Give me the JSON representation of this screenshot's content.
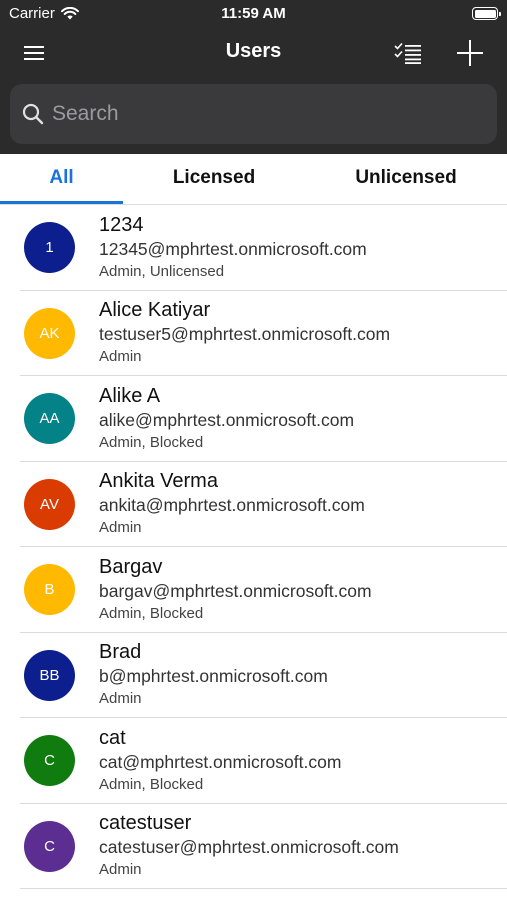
{
  "status": {
    "carrier": "Carrier",
    "time": "11:59 AM"
  },
  "nav": {
    "title": "Users",
    "menu_icon": "hamburger-icon",
    "select_icon": "checklist-icon",
    "add_icon": "plus-icon"
  },
  "search": {
    "placeholder": "Search"
  },
  "tabs": [
    {
      "label": "All",
      "active": true
    },
    {
      "label": "Licensed"
    },
    {
      "label": "Unlicensed"
    }
  ],
  "users": [
    {
      "initials": "1",
      "name": "1234",
      "email": "12345@mphrtest.onmicrosoft.com",
      "roles": "Admin, Unlicensed",
      "color": "#0d1f8f"
    },
    {
      "initials": "AK",
      "name": "Alice Katiyar",
      "email": "testuser5@mphrtest.onmicrosoft.com",
      "roles": "Admin",
      "color": "#ffb900"
    },
    {
      "initials": "AA",
      "name": "Alike A",
      "email": "alike@mphrtest.onmicrosoft.com",
      "roles": "Admin, Blocked",
      "color": "#038387"
    },
    {
      "initials": "AV",
      "name": "Ankita Verma",
      "email": "ankita@mphrtest.onmicrosoft.com",
      "roles": "Admin",
      "color": "#da3b01"
    },
    {
      "initials": "B",
      "name": "Bargav",
      "email": "bargav@mphrtest.onmicrosoft.com",
      "roles": "Admin, Blocked",
      "color": "#ffb900"
    },
    {
      "initials": "BB",
      "name": "Brad",
      "email": "b@mphrtest.onmicrosoft.com",
      "roles": "Admin",
      "color": "#0d1f8f"
    },
    {
      "initials": "C",
      "name": "cat",
      "email": "cat@mphrtest.onmicrosoft.com",
      "roles": "Admin, Blocked",
      "color": "#107c10"
    },
    {
      "initials": "C",
      "name": "catestuser",
      "email": "catestuser@mphrtest.onmicrosoft.com",
      "roles": "Admin",
      "color": "#5c2e91"
    }
  ]
}
